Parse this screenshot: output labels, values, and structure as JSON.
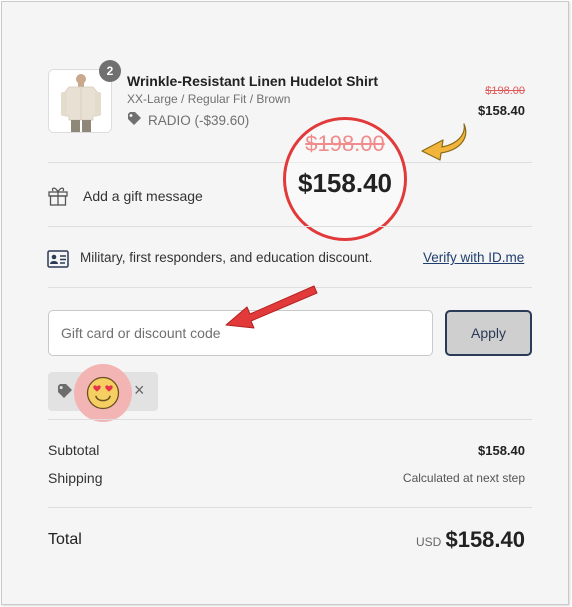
{
  "product": {
    "quantity": "2",
    "name": "Wrinkle-Resistant Linen Hudelot Shirt",
    "variant": "XX-Large / Regular Fit / Brown",
    "discount": "RADIO (-$39.60)",
    "original_price": "$198.00",
    "price": "$158.40"
  },
  "callout": {
    "original_price": "$198.00",
    "price": "$158.40",
    "circle_color": "#e23a3a"
  },
  "gift": {
    "label": "Add a gift message",
    "icon": "gift-icon"
  },
  "military": {
    "label": "Military, first responders, and education discount.",
    "link": "Verify with ID.me",
    "icon": "id-card-icon"
  },
  "discount_form": {
    "placeholder": "Gift card or discount code",
    "value": "",
    "apply_label": "Apply"
  },
  "applied_code": {
    "icon": "tag-icon",
    "remove_label": "×"
  },
  "summary": {
    "subtotal_label": "Subtotal",
    "subtotal_value": "$158.40",
    "shipping_label": "Shipping",
    "shipping_value": "Calculated at next step",
    "total_label": "Total",
    "currency": "USD",
    "total_value": "$158.40"
  },
  "colors": {
    "accent": "#2b3a57",
    "strike_red": "#e05a5a",
    "arrow_red": "#e23a3a",
    "arrow_yellow": "#f2b53a"
  }
}
